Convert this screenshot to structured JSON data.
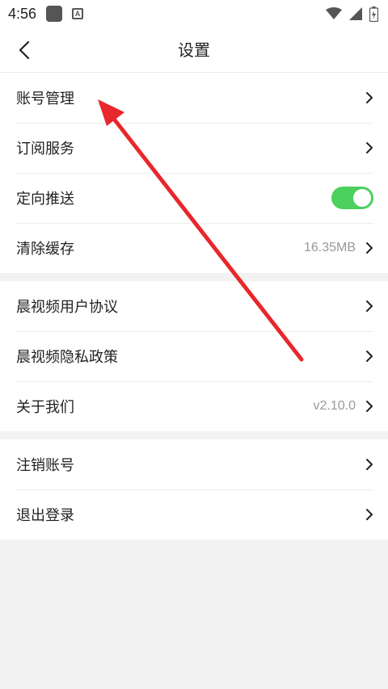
{
  "status_bar": {
    "time": "4:56"
  },
  "header": {
    "title": "设置"
  },
  "groups": [
    {
      "items": [
        {
          "label": "账号管理"
        },
        {
          "label": "订阅服务"
        },
        {
          "label": "定向推送",
          "toggle_on": true
        },
        {
          "label": "清除缓存",
          "value": "16.35MB"
        }
      ]
    },
    {
      "items": [
        {
          "label": "晨视频用户协议"
        },
        {
          "label": "晨视频隐私政策"
        },
        {
          "label": "关于我们",
          "value": "v2.10.0"
        }
      ]
    },
    {
      "items": [
        {
          "label": "注销账号"
        },
        {
          "label": "退出登录"
        }
      ]
    }
  ],
  "colors": {
    "accent_toggle": "#4cd05e",
    "annotation_arrow": "#e8272c",
    "page_bg": "#f2f2f2"
  },
  "icons": [
    "back-icon",
    "chevron-right-icon",
    "wifi-icon",
    "signal-icon",
    "battery-icon"
  ]
}
